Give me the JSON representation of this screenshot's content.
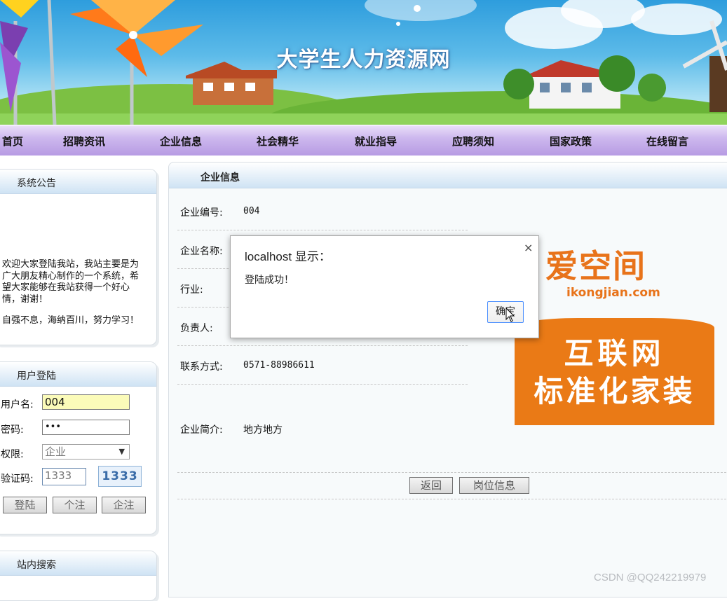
{
  "banner": {
    "title": "大学生人力资源网"
  },
  "nav": {
    "items": [
      "首页",
      "招聘资讯",
      "企业信息",
      "社会精华",
      "就业指导",
      "应聘须知",
      "国家政策",
      "在线留言"
    ]
  },
  "notice": {
    "title": "系统公告",
    "paragraph1": "欢迎大家登陆我站，我站主要是为广大朋友精心制作的一个系统，希望大家能够在我站获得一个好心情，谢谢！",
    "paragraph2": "自强不息，海纳百川，努力学习！"
  },
  "login": {
    "title": "用户登陆",
    "username_label": "用户名:",
    "username_value": "004",
    "password_label": "密码:",
    "password_value": "•••",
    "role_label": "权限:",
    "role_value": "企业",
    "captcha_label": "验证码:",
    "captcha_value": "1333",
    "captcha_image_text": "1333",
    "buttons": [
      "登陆",
      "个注",
      "企注"
    ]
  },
  "search": {
    "title": "站内搜索"
  },
  "main": {
    "title": "企业信息",
    "fields": [
      {
        "label": "企业编号:",
        "value": "004"
      },
      {
        "label": "企业名称:",
        "value": ""
      },
      {
        "label": "行业:",
        "value": ""
      },
      {
        "label": "负责人:",
        "value": ""
      },
      {
        "label": "联系方式:",
        "value": "0571-88986611"
      },
      {
        "label": "企业简介:",
        "value": "地方地方"
      }
    ],
    "buttons": {
      "back": "返回",
      "jobs": "岗位信息"
    }
  },
  "dialog": {
    "title": "localhost 显示：",
    "message": "登陆成功！",
    "ok_label": "确定",
    "close_symbol": "×"
  },
  "ad": {
    "logo_text": "爱空间",
    "domain": "ikongjian.com",
    "line1": "互联网",
    "line2": "标准化家装",
    "colors": {
      "orange": "#ea7a16"
    }
  },
  "watermark": "CSDN @QQ242219979"
}
